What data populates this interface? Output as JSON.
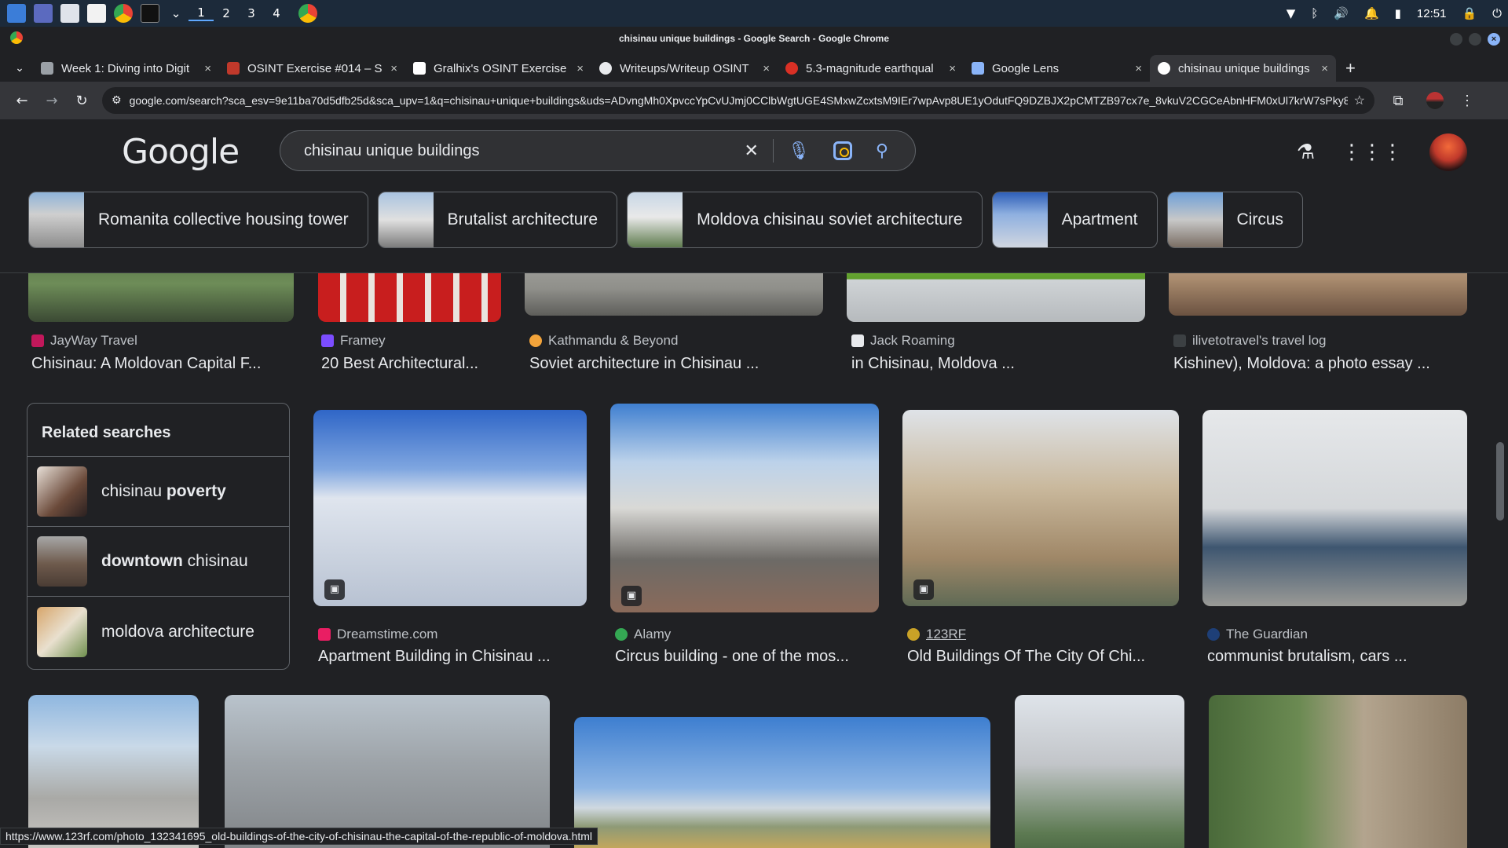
{
  "taskbar": {
    "workspaces": [
      "1",
      "2",
      "3",
      "4"
    ],
    "clock": "12:51"
  },
  "window": {
    "title": "chisinau unique buildings - Google Search - Google Chrome"
  },
  "tabs": [
    {
      "label": "Week 1: Diving into Digit",
      "close": "×"
    },
    {
      "label": "OSINT Exercise #014 – S",
      "close": "×"
    },
    {
      "label": "Gralhix's OSINT Exercise",
      "close": "×"
    },
    {
      "label": "Writeups/Writeup OSINT",
      "close": "×"
    },
    {
      "label": "5.3-magnitude earthqual",
      "close": "×"
    },
    {
      "label": "Google Lens",
      "close": "×"
    },
    {
      "label": "chisinau unique buildings",
      "close": "×"
    }
  ],
  "toolbar": {
    "url": "google.com/search?sca_esv=9e11ba70d5dfb25d&sca_upv=1&q=chisinau+unique+buildings&uds=ADvngMh0XpvccYpCvUJmj0CClbWgtUGE4SMxwZcxtsM9IEr7wpAvp8UE1yOdutFQ9DZBJX2pCMTZB97cx7e_8vkuV2CGCeAbnHFM0xUl7krW7sPky8UNXF..."
  },
  "google": {
    "logo": "Google",
    "query": "chisinau unique buildings"
  },
  "chips": [
    "Romanita collective housing tower",
    "Brutalist architecture",
    "Moldova chisinau soviet architecture",
    "Apartment",
    "Circus"
  ],
  "row1": [
    {
      "source": "JayWay Travel",
      "caption": "Chisinau: A Moldovan Capital F..."
    },
    {
      "source": "Framey",
      "caption": "20 Best Architectural..."
    },
    {
      "source": "Kathmandu & Beyond",
      "caption": "Soviet architecture in Chisinau ..."
    },
    {
      "source": "Jack Roaming",
      "caption": "in Chisinau, Moldova ..."
    },
    {
      "source": "ilivetotravel's travel log",
      "caption": "Kishinev), Moldova: a photo essay ..."
    }
  ],
  "related": {
    "heading": "Related searches",
    "items": [
      {
        "pre": "chisinau ",
        "bold": "poverty",
        "post": ""
      },
      {
        "pre": "",
        "bold": "downtown",
        "post": " chisinau"
      },
      {
        "pre": "moldova architecture",
        "bold": "",
        "post": ""
      }
    ]
  },
  "row2": [
    {
      "source": "Dreamstime.com",
      "caption": "Apartment Building in Chisinau ..."
    },
    {
      "source": "Alamy",
      "caption": "Circus building - one of the mos..."
    },
    {
      "source": "123RF",
      "caption": "Old Buildings Of The City Of Chi..."
    },
    {
      "source": "The Guardian",
      "caption": "communist brutalism, cars ..."
    }
  ],
  "status_url": "https://www.123rf.com/photo_132341695_old-buildings-of-the-city-of-chisinau-the-capital-of-the-republic-of-moldova.html",
  "colors": {
    "background": "#202124",
    "accent": "#8ab4f8"
  }
}
